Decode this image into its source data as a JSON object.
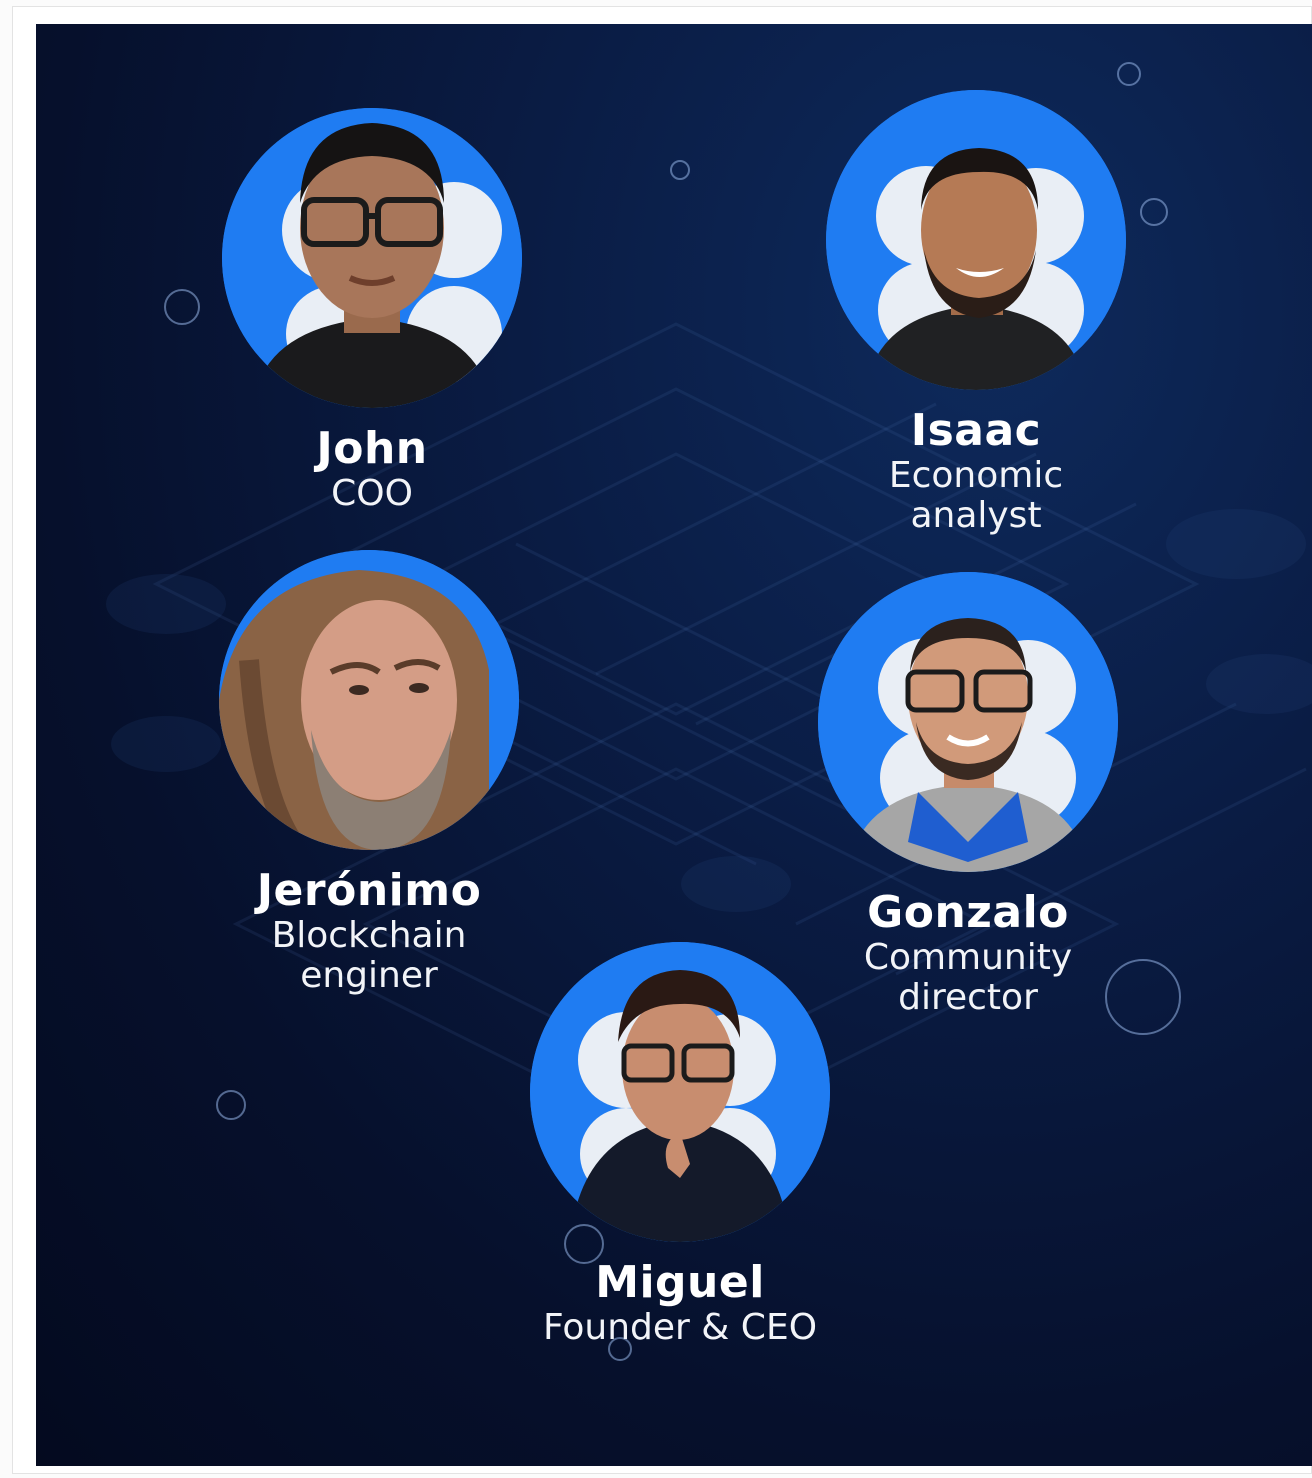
{
  "members": [
    {
      "name": "John",
      "role": "COO",
      "avatar": "john-photo"
    },
    {
      "name": "Isaac",
      "role": "Economic analyst",
      "avatar": "isaac-photo"
    },
    {
      "name": "Jerónimo",
      "role": "Blockchain enginer",
      "avatar": "jeronimo-photo"
    },
    {
      "name": "Gonzalo",
      "role": "Community director",
      "avatar": "gonzalo-photo"
    },
    {
      "name": "Miguel",
      "role": "Founder & CEO",
      "avatar": "miguel-photo"
    }
  ],
  "colors": {
    "background": "#06102c",
    "avatar_ring": "#1f7cf2",
    "text": "#ffffff"
  }
}
